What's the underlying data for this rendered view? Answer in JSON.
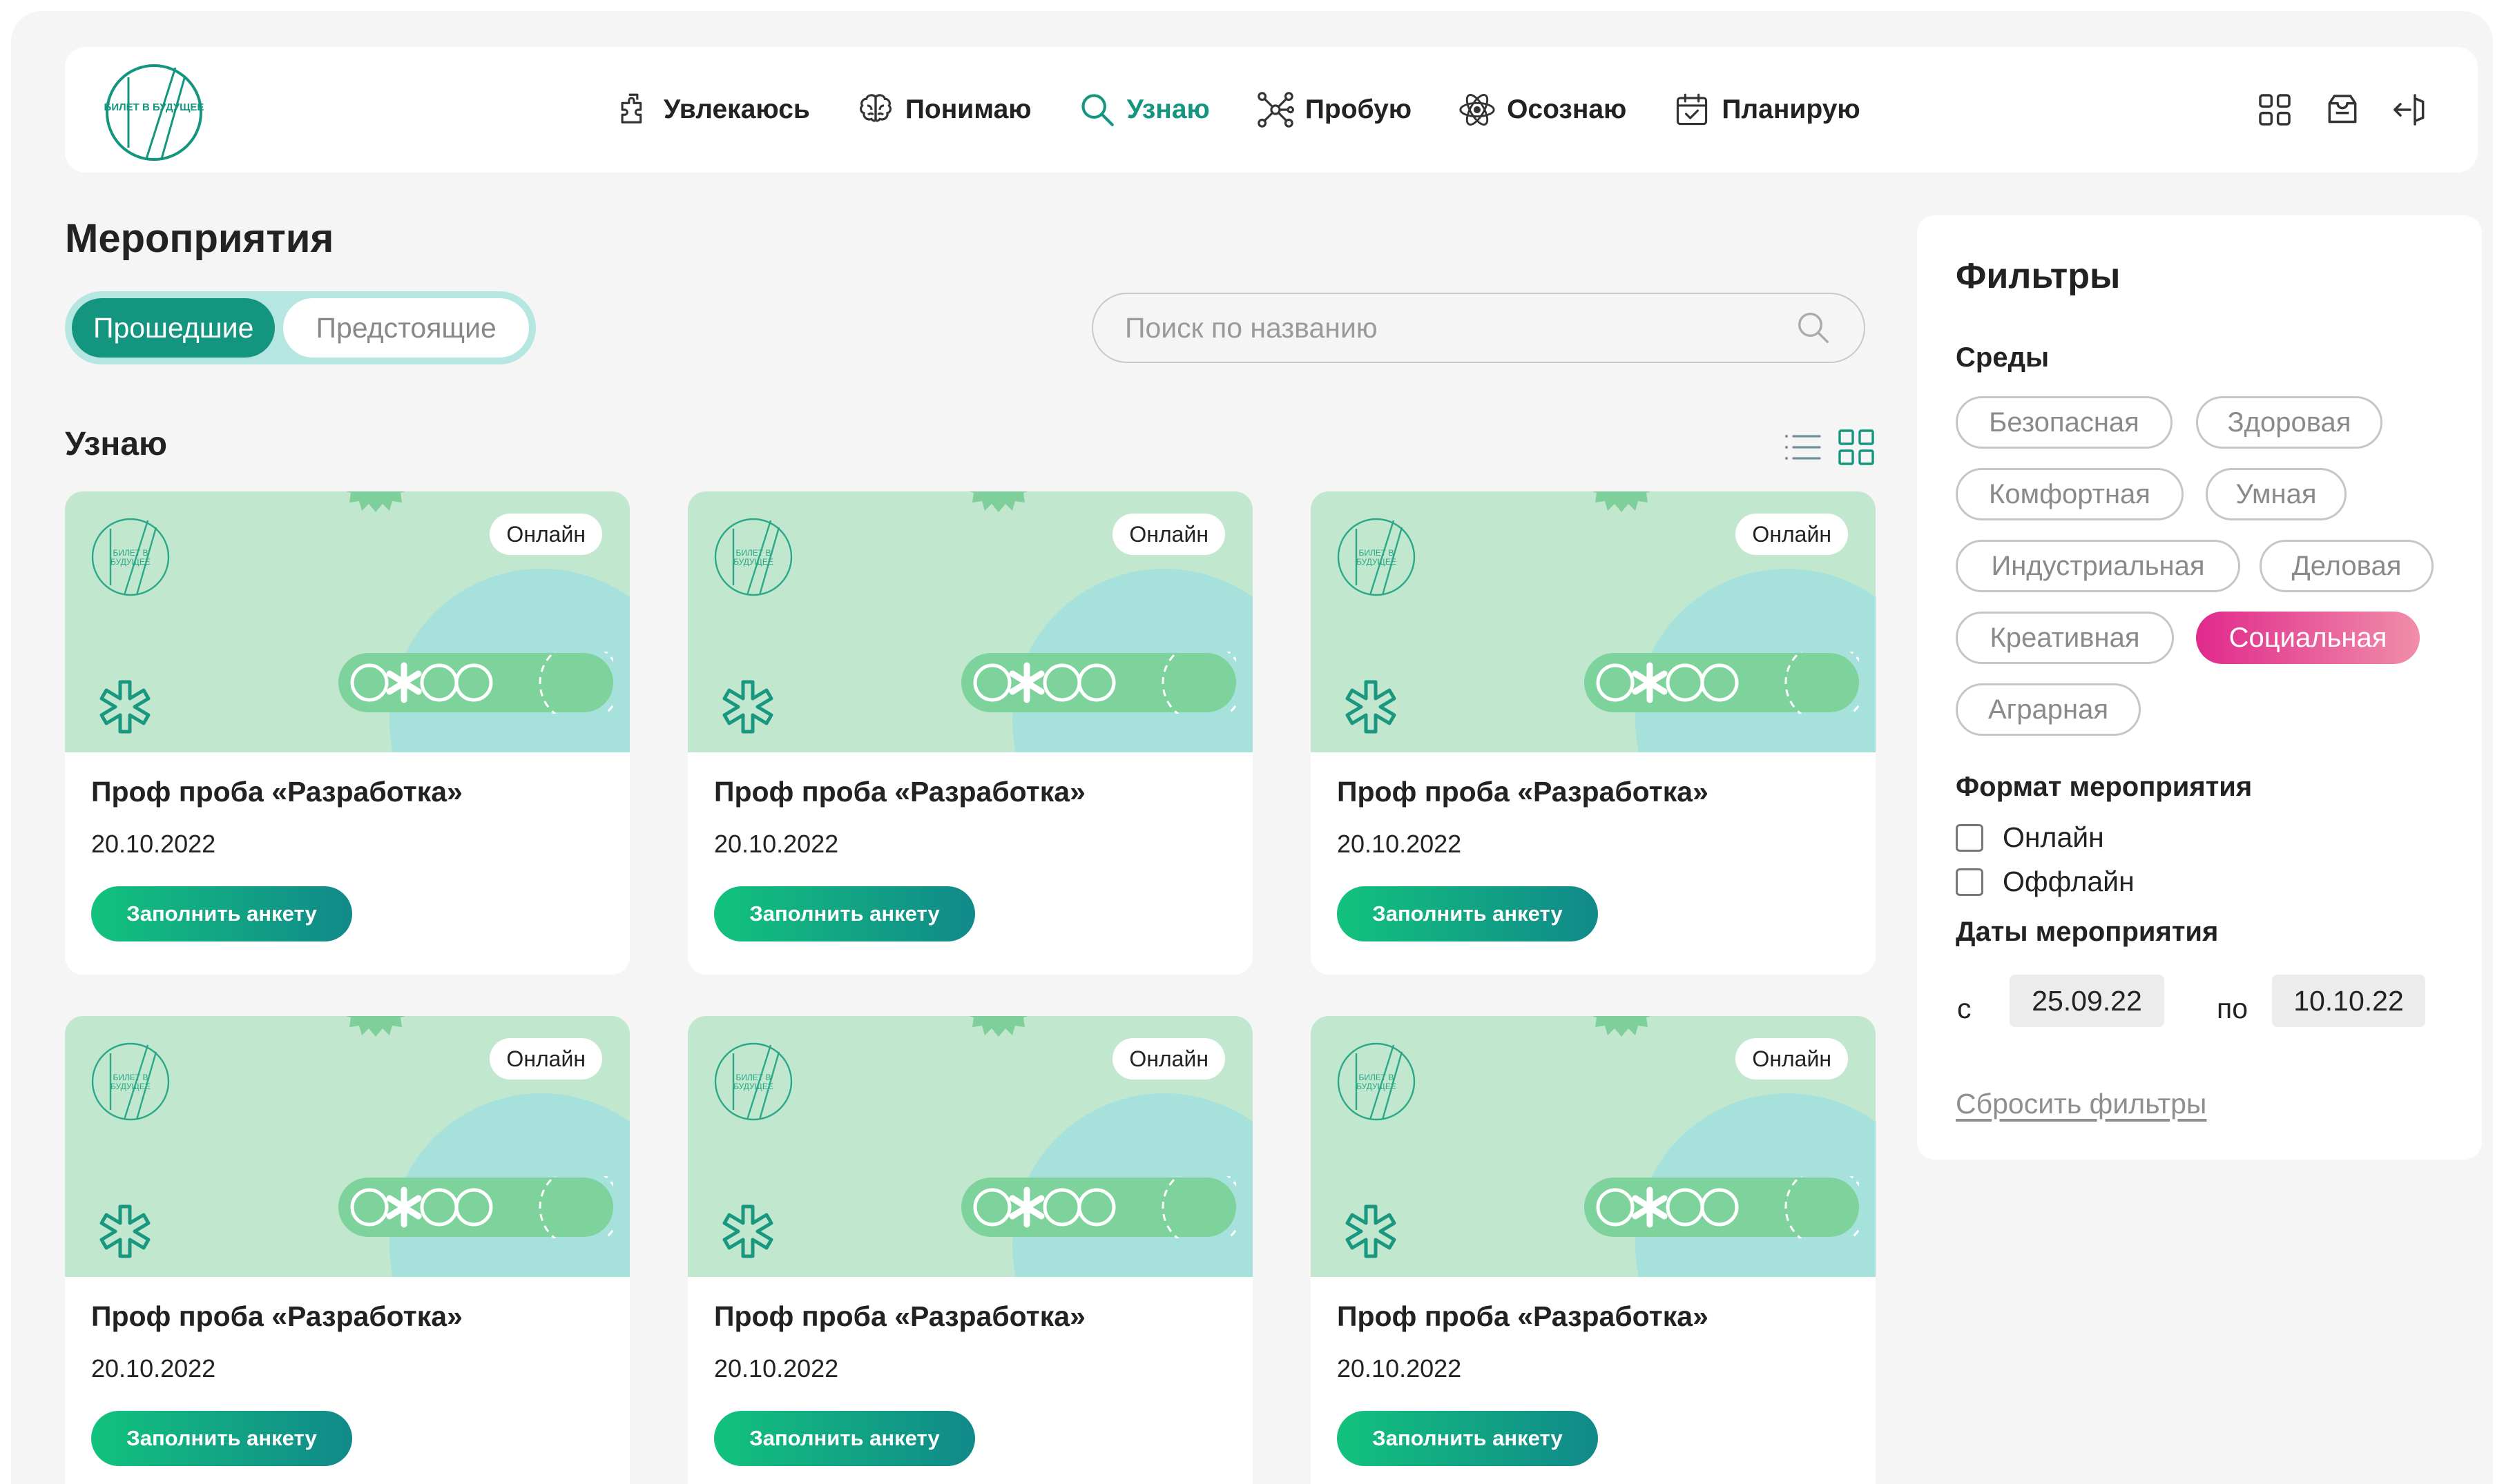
{
  "header": {
    "logo_text": "БИЛЕТ В БУДУЩЕЕ",
    "nav": [
      {
        "label": "Увлекаюсь",
        "icon": "puzzle-icon",
        "active": false
      },
      {
        "label": "Понимаю",
        "icon": "brain-icon",
        "active": false
      },
      {
        "label": "Узнаю",
        "icon": "search-icon",
        "active": true
      },
      {
        "label": "Пробую",
        "icon": "network-icon",
        "active": false
      },
      {
        "label": "Осознаю",
        "icon": "atom-icon",
        "active": false
      },
      {
        "label": "Планирую",
        "icon": "calendar-check-icon",
        "active": false
      }
    ],
    "right_icons": [
      "grid-icon",
      "inbox-icon",
      "logout-icon"
    ]
  },
  "main": {
    "title": "Мероприятия",
    "tabs": [
      {
        "label": "Прошедшие",
        "active": true
      },
      {
        "label": "Предстоящие",
        "active": false
      }
    ],
    "search": {
      "placeholder": "Поиск по названию",
      "value": ""
    },
    "section_title": "Узнаю",
    "view_modes": [
      {
        "icon": "list-view-icon",
        "active": false
      },
      {
        "icon": "grid-view-icon",
        "active": true
      }
    ],
    "cards": [
      {
        "badge": "Онлайн",
        "title": "Проф проба «Разработка»",
        "date": "20.10.2022",
        "button": "Заполнить анкету"
      },
      {
        "badge": "Онлайн",
        "title": "Проф проба «Разработка»",
        "date": "20.10.2022",
        "button": "Заполнить анкету"
      },
      {
        "badge": "Онлайн",
        "title": "Проф проба «Разработка»",
        "date": "20.10.2022",
        "button": "Заполнить анкету"
      },
      {
        "badge": "Онлайн",
        "title": "Проф проба «Разработка»",
        "date": "20.10.2022",
        "button": "Заполнить анкету"
      },
      {
        "badge": "Онлайн",
        "title": "Проф проба «Разработка»",
        "date": "20.10.2022",
        "button": "Заполнить анкету"
      },
      {
        "badge": "Онлайн",
        "title": "Проф проба «Разработка»",
        "date": "20.10.2022",
        "button": "Заполнить анкету"
      }
    ]
  },
  "filters": {
    "title": "Фильтры",
    "env_label": "Среды",
    "environments": [
      {
        "label": "Безопасная",
        "selected": false
      },
      {
        "label": "Здоровая",
        "selected": false
      },
      {
        "label": "Комфортная",
        "selected": false
      },
      {
        "label": "Умная",
        "selected": false
      },
      {
        "label": "Индустриальная",
        "selected": false
      },
      {
        "label": "Деловая",
        "selected": false
      },
      {
        "label": "Креативная",
        "selected": false
      },
      {
        "label": "Социальная",
        "selected": true
      },
      {
        "label": "Аграрная",
        "selected": false
      }
    ],
    "format_label": "Формат мероприятия",
    "formats": [
      {
        "label": "Онлайн",
        "checked": false
      },
      {
        "label": "Оффлайн",
        "checked": false
      }
    ],
    "dates_label": "Даты мероприятия",
    "from_word": "с",
    "from_value": "25.09.22",
    "to_word": "по",
    "to_value": "10.10.22",
    "reset": "Сбросить фильтры"
  },
  "colors": {
    "accent": "#14957f",
    "tab_track": "#b6e6e2",
    "button_gradient": [
      "#12c27d",
      "#11898a"
    ],
    "chip_selected": [
      "#e0298c",
      "#f08ea9"
    ],
    "banner_bg": "#c2e7cf",
    "banner_circle": "#a6e1dc"
  }
}
